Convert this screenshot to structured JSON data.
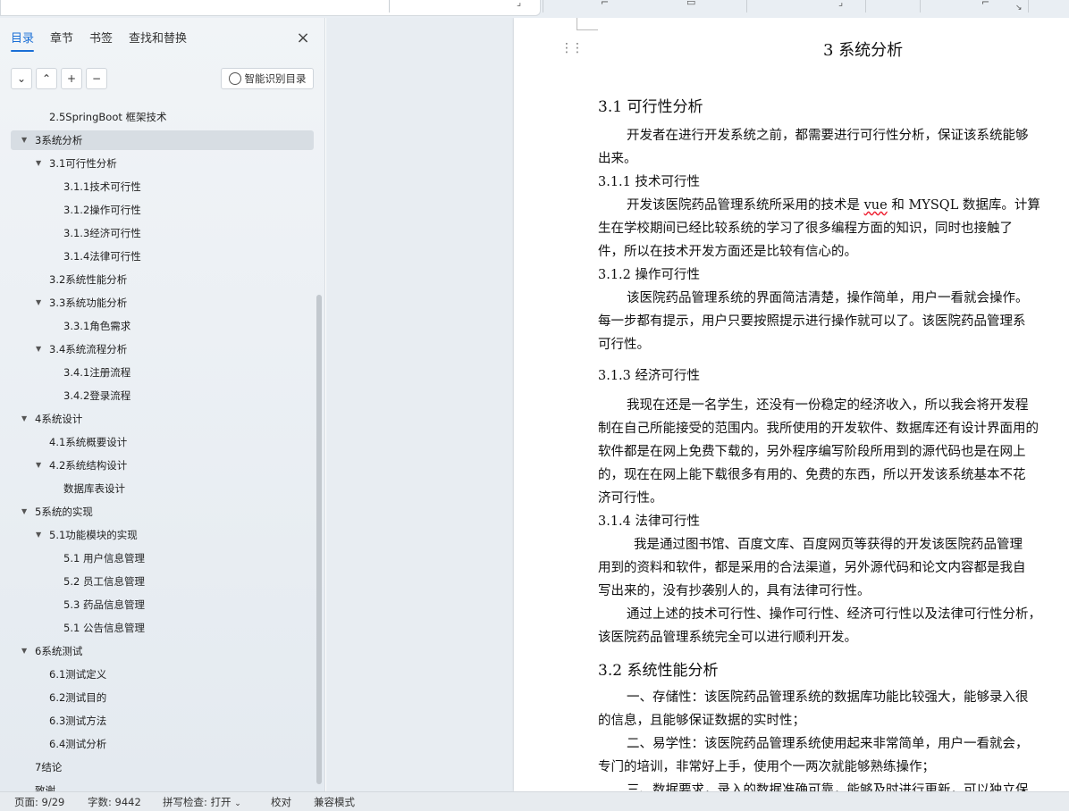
{
  "nav": {
    "tabs": [
      "目录",
      "章节",
      "书签",
      "查找和替换"
    ],
    "ai_button": "智能识别目录",
    "toc": [
      {
        "label": "2.5SpringBoot 框架技术"
      },
      {
        "label": "3系统分析"
      },
      {
        "label": "3.1可行性分析"
      },
      {
        "label": "3.1.1技术可行性"
      },
      {
        "label": "3.1.2操作可行性"
      },
      {
        "label": "3.1.3经济可行性"
      },
      {
        "label": "3.1.4法律可行性"
      },
      {
        "label": "3.2系统性能分析"
      },
      {
        "label": "3.3系统功能分析"
      },
      {
        "label": "3.3.1角色需求"
      },
      {
        "label": "3.4系统流程分析"
      },
      {
        "label": "3.4.1注册流程"
      },
      {
        "label": "3.4.2登录流程"
      },
      {
        "label": "4系统设计"
      },
      {
        "label": "4.1系统概要设计"
      },
      {
        "label": "4.2系统结构设计"
      },
      {
        "label": "数据库表设计"
      },
      {
        "label": "5系统的实现"
      },
      {
        "label": "5.1功能模块的实现"
      },
      {
        "label": "5.1 用户信息管理"
      },
      {
        "label": "5.2  员工信息管理"
      },
      {
        "label": "5.3 药品信息管理"
      },
      {
        "label": "5.1 公告信息管理"
      },
      {
        "label": "6系统测试"
      },
      {
        "label": "6.1测试定义"
      },
      {
        "label": "6.2测试目的"
      },
      {
        "label": "6.3测试方法"
      },
      {
        "label": "6.4测试分析"
      },
      {
        "label": "7结论"
      },
      {
        "label": "致谢"
      }
    ]
  },
  "doc": {
    "lines": [
      "3  系统分析",
      "3.1  可行性分析",
      "开发者在进行开发系统之前，都需要进行可行性分析，保证该系统能够",
      "出来。",
      "3.1.1  技术可行性",
      "开发该医院药品管理系统所采用的技术是 ",
      "vue",
      " 和 MYSQL 数据库。计算",
      "生在学校期间已经比较系统的学习了很多编程方面的知识，同时也接触了",
      "件，所以在技术开发方面还是比较有信心的。",
      "3.1.2  操作可行性",
      "该医院药品管理系统的界面简洁清楚，操作简单，用户一看就会操作。",
      "每一步都有提示，用户只要按照提示进行操作就可以了。该医院药品管理系",
      "可行性。",
      "3.1.3  经济可行性",
      "我现在还是一名学生，还没有一份稳定的经济收入，所以我会将开发程",
      "制在自己所能接受的范围内。我所使用的开发软件、数据库还有设计界面用的",
      "软件都是在网上免费下载的，另外程序编写阶段所用到的源代码也是在网上",
      "的，现在在网上能下载很多有用的、免费的东西，所以开发该系统基本不花",
      "济可行性。",
      "3.1.4  法律可行性",
      "我是通过图书馆、百度文库、百度网页等获得的开发该医院药品管理",
      "用到的资料和软件，都是采用的合法渠道，另外源代码和论文内容都是我自",
      "写出来的，没有抄袭别人的，具有法律可行性。",
      "通过上述的技术可行性、操作可行性、经济可行性以及法律可行性分析，",
      "该医院药品管理系统完全可以进行顺利开发。",
      "3.2  系统性能分析",
      "一、存储性：该医院药品管理系统的数据库功能比较强大，能够录入很",
      "的信息，且能够保证数据的实时性；",
      "二、易学性：该医院药品管理系统使用起来非常简单，用户一看就会，",
      "专门的培训，非常好上手，使用个一两次就能够熟练操作；",
      "三、数据要求，录入的数据准确可靠，能够及时进行更新，可以独立保"
    ]
  },
  "status": {
    "page": "页面: 9/29",
    "words": "字数: 9442",
    "spell": "拼写检查: 打开",
    "proof": "校对",
    "compat": "兼容模式"
  }
}
